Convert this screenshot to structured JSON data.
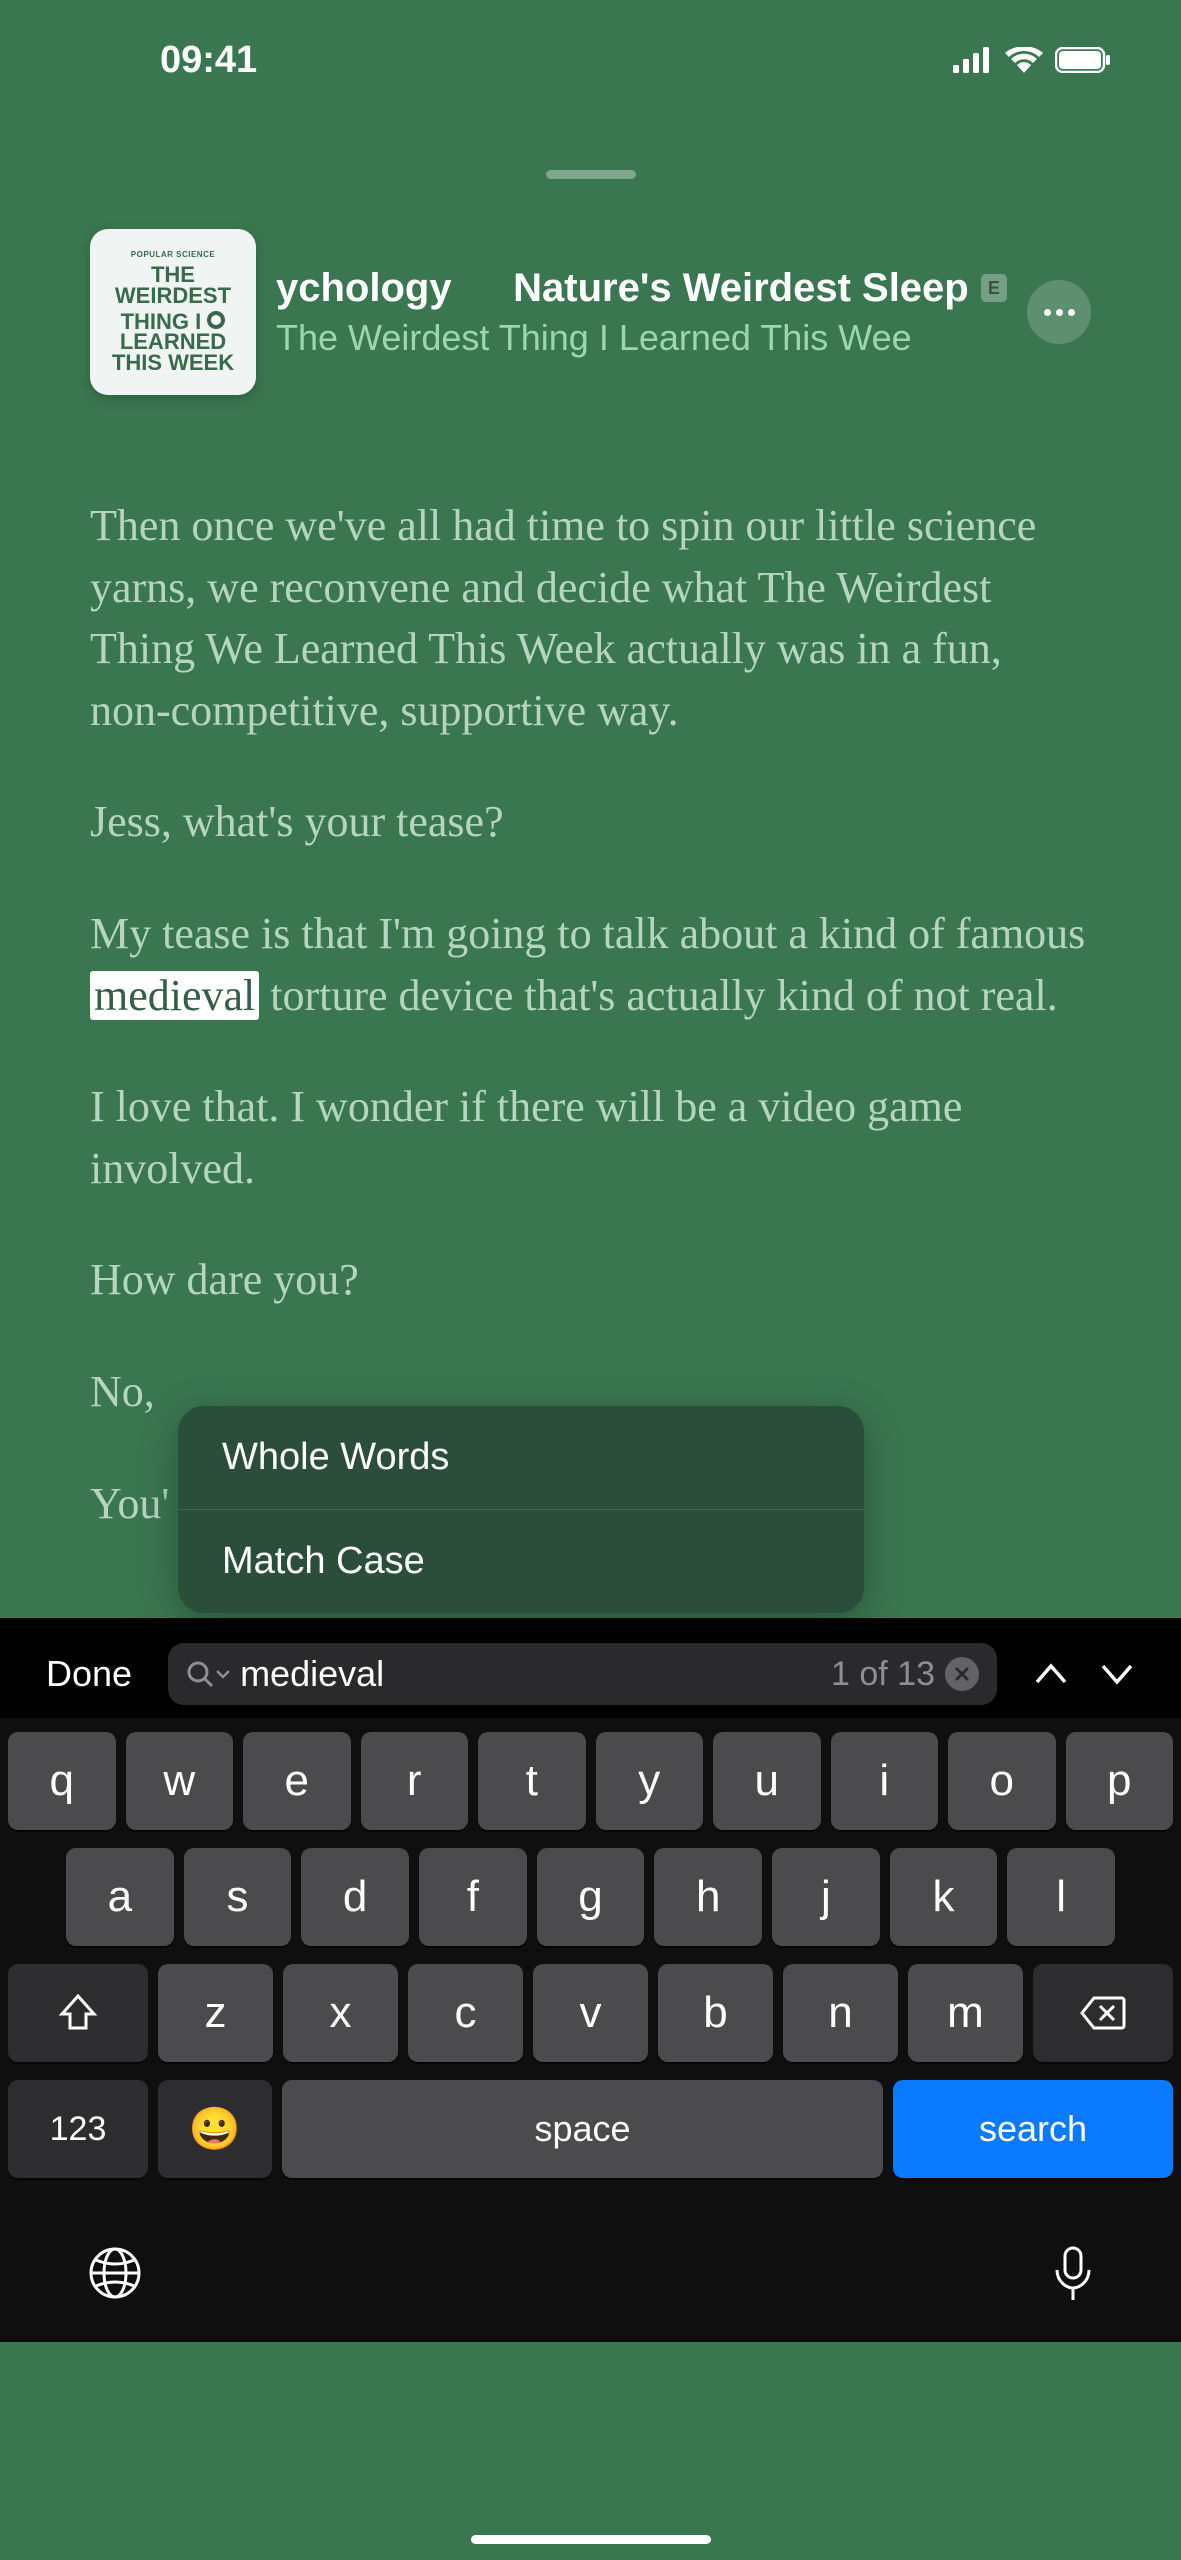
{
  "statusBar": {
    "time": "09:41"
  },
  "header": {
    "cover": {
      "topText": "POPULAR SCIENCE",
      "mainText": "THE WEIRDEST THING I LEARNED THIS WEEK"
    },
    "episodeTitlePart1": "ychology",
    "episodeTitlePart2": "Nature's Weirdest Sleep",
    "explicitLabel": "E",
    "podcastName": "The Weirdest Thing I Learned This Wee"
  },
  "transcript": {
    "p1_pre": "Then once we've all had time to spin our little science yarns, we reconvene and decide what The Weirdest Thing We Learned This Week actually was in a fun, non-competitive, supportive way.",
    "p2": "Jess, what's your tease?",
    "p3_pre": "My tease is that I'm going to talk about a kind of famous ",
    "p3_highlight": "medieval",
    "p3_post": " torture device that's actually kind of not real.",
    "p4": "I love that. I wonder if there will be a video game involved.",
    "p5": "How dare you?",
    "p6": "No, ",
    "p7": "You'"
  },
  "options": {
    "item1": "Whole Words",
    "item2": "Match Case"
  },
  "search": {
    "doneLabel": "Done",
    "value": "medieval",
    "countText": "1 of 13"
  },
  "keyboard": {
    "row1": [
      "q",
      "w",
      "e",
      "r",
      "t",
      "y",
      "u",
      "i",
      "o",
      "p"
    ],
    "row2": [
      "a",
      "s",
      "d",
      "f",
      "g",
      "h",
      "j",
      "k",
      "l"
    ],
    "row3": [
      "z",
      "x",
      "c",
      "v",
      "b",
      "n",
      "m"
    ],
    "numKey": "123",
    "spaceLabel": "space",
    "searchLabel": "search"
  }
}
